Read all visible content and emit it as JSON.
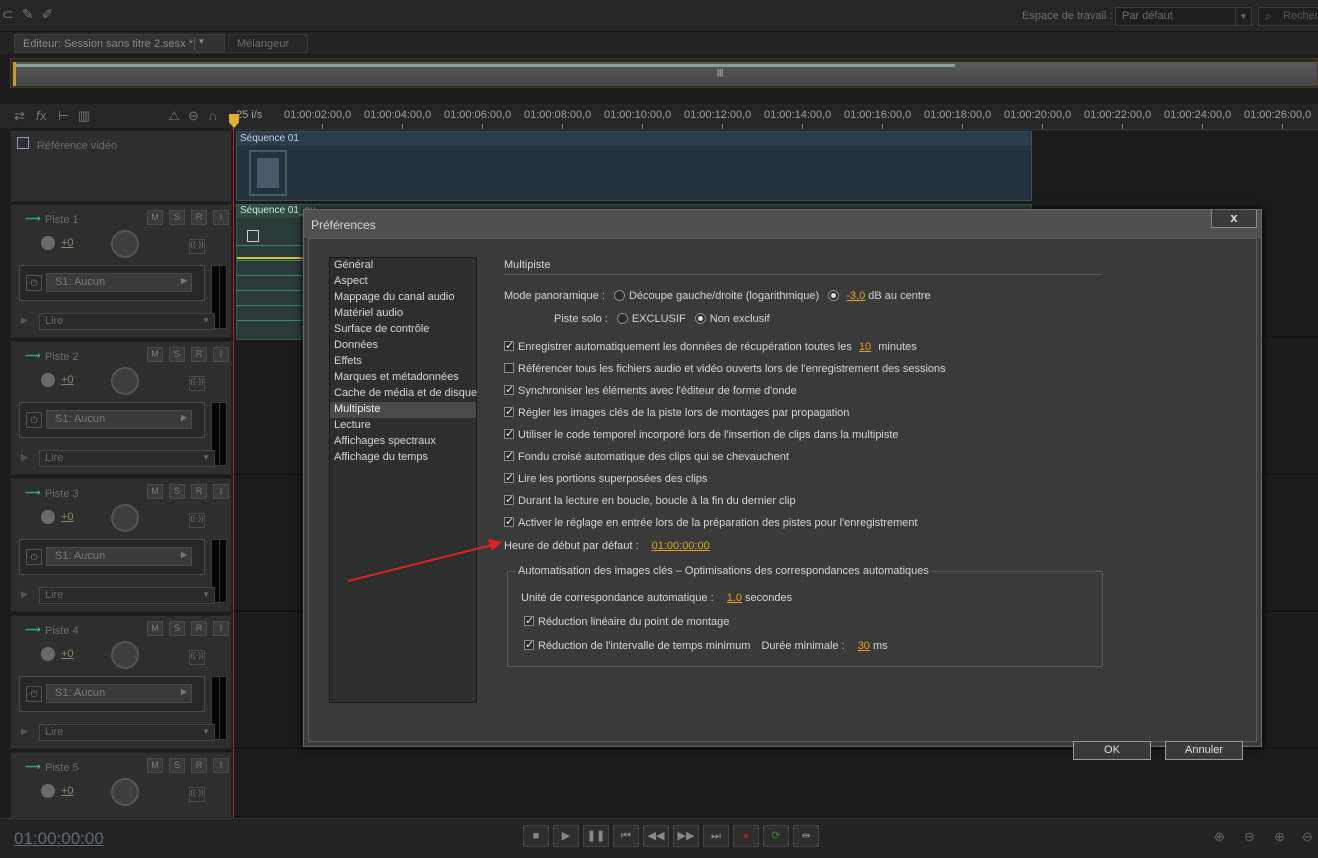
{
  "topbar": {
    "tool_icons": [
      "lasso-icon",
      "brush-icon",
      "healing-icon"
    ],
    "workspace_label": "Espace de travail :",
    "workspace_value": "Par défaut",
    "search_placeholder": "Recher"
  },
  "tabs": {
    "editor": "Editeur: Session sans titre 2.sesx *",
    "mixer": "Mélangeur"
  },
  "ruler": {
    "fps": "25 i/s",
    "ticks": [
      "01:00:02:00,0",
      "01:00:04:00,0",
      "01:00:06:00,0",
      "01:00:08:00,0",
      "01:00:10:00,0",
      "01:00:12:00,0",
      "01:00:14:00,0",
      "01:00:16:00,0",
      "01:00:18:00,0",
      "01:00:20:00,0",
      "01:00:22:00,0",
      "01:00:24:00,0",
      "01:00:26:00,0"
    ]
  },
  "video_track": {
    "label": "Référence vidéo",
    "clip": "Séquence 01"
  },
  "audio_clip": "Séquence 01_au",
  "tracks": [
    {
      "name": "Piste 1",
      "volume": "+0",
      "fx": "S1: Aucun",
      "mode": "Lire"
    },
    {
      "name": "Piste 2",
      "volume": "+0",
      "fx": "S1: Aucun",
      "mode": "Lire"
    },
    {
      "name": "Piste 3",
      "volume": "+0",
      "fx": "S1: Aucun",
      "mode": "Lire"
    },
    {
      "name": "Piste 4",
      "volume": "+0",
      "fx": "S1: Aucun",
      "mode": "Lire"
    },
    {
      "name": "Piste 5",
      "volume": "+0"
    }
  ],
  "track_buttons": [
    "M",
    "S",
    "R",
    "I"
  ],
  "transport": {
    "timecode": "01:00:00:00"
  },
  "dialog": {
    "title": "Préférences",
    "close": "x",
    "categories": [
      "Général",
      "Aspect",
      "Mappage du canal audio",
      "Matériel audio",
      "Surface de contrôle",
      "Données",
      "Effets",
      "Marques et métadonnées",
      "Cache de média et de disque",
      "Multipiste",
      "Lecture",
      "Affichages spectraux",
      "Affichage du temps"
    ],
    "selected_category": "Multipiste",
    "section_title": "Multipiste",
    "pan_mode_label": "Mode panoramique :",
    "pan_option1": "Découpe gauche/droite (logarithmique)",
    "pan_value": "-3,0",
    "pan_option2_suffix": "dB au centre",
    "solo_label": "Piste solo :",
    "solo_option1": "EXCLUSIF",
    "solo_option2": "Non exclusif",
    "autosave_prefix": "Enregistrer automatiquement les données de récupération toutes les",
    "autosave_value": "10",
    "autosave_suffix": "minutes",
    "checks": [
      {
        "label": "Référencer tous les fichiers audio et vidéo ouverts lors de l'enregistrement des sessions",
        "on": false
      },
      {
        "label": "Synchroniser les éléments avec l'éditeur de forme d'onde",
        "on": true
      },
      {
        "label": "Régler les images clés de la piste lors de montages par propagation",
        "on": true
      },
      {
        "label": "Utiliser le code temporel incorporé lors de l'insertion de clips dans la multipiste",
        "on": true
      },
      {
        "label": "Fondu croisé automatique des clips qui se chevauchent",
        "on": true
      },
      {
        "label": "Lire les portions superposées des clips",
        "on": true
      },
      {
        "label": "Durant la lecture en boucle, boucle à la fin du dernier clip",
        "on": true
      },
      {
        "label": "Activer le réglage en entrée lors de la préparation des pistes pour l'enregistrement",
        "on": true
      }
    ],
    "start_time_label": "Heure de début par défaut :",
    "start_time_value": "01:00:00:00",
    "auto_group_title": "Automatisation des images clés – Optimisations des correspondances automatiques",
    "match_unit_label": "Unité de correspondance automatique :",
    "match_unit_value": "1,0",
    "match_unit_suffix": "secondes",
    "linear_reduction": "Réduction linéaire du point de montage",
    "min_interval": "Réduction de l'intervalle de temps minimum",
    "min_duration_label": "Durée minimale :",
    "min_duration_value": "30",
    "min_duration_unit": "ms",
    "ok": "OK",
    "cancel": "Annuler"
  },
  "colors": {
    "accent": "#e8a020",
    "playhead": "#c02020",
    "annotation_arrow": "#e02020"
  }
}
